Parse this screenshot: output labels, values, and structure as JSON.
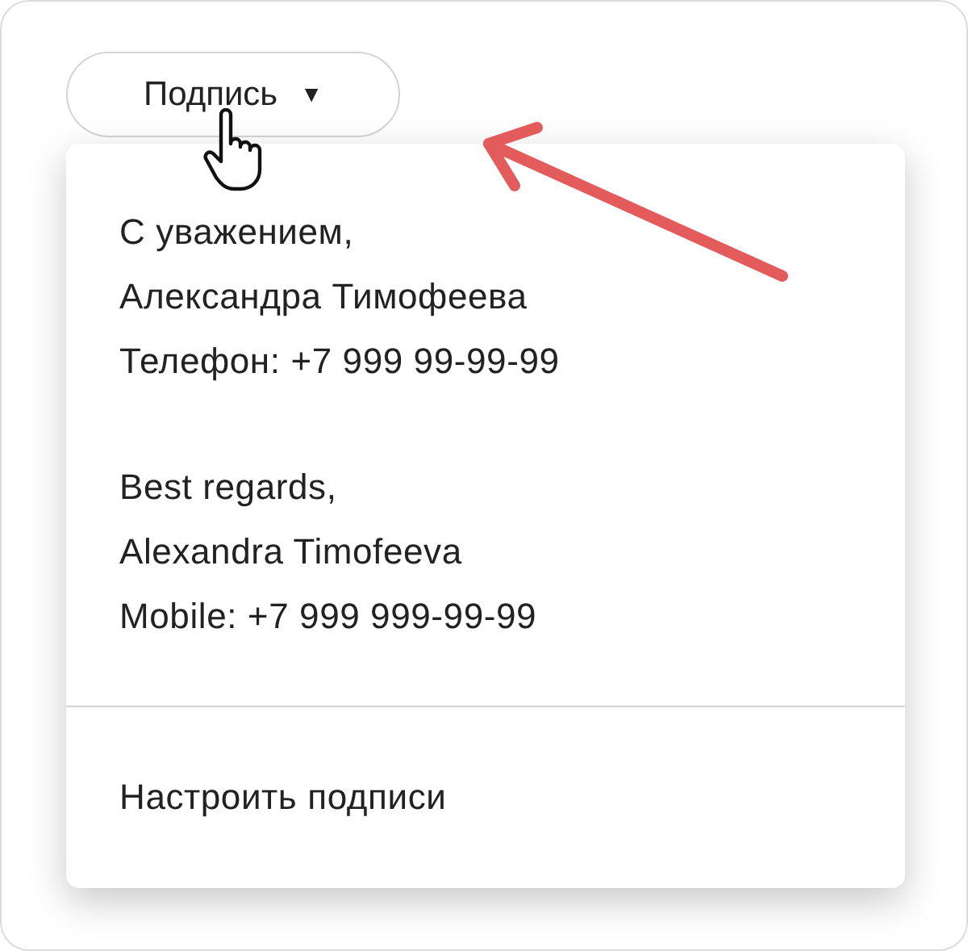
{
  "dropdown_button": {
    "label": "Подпись",
    "caret": "▼",
    "expanded": true
  },
  "signatures": [
    {
      "lines": [
        "С уважением,",
        "Александра Тимофеева",
        "Телефон: +7 999 99-99-99"
      ]
    },
    {
      "lines": [
        "Best regards,",
        "Alexandra Timofeeva",
        "Mobile: +7 999 999-99-99"
      ]
    }
  ],
  "settings_item": {
    "label": "Настроить подписи"
  }
}
